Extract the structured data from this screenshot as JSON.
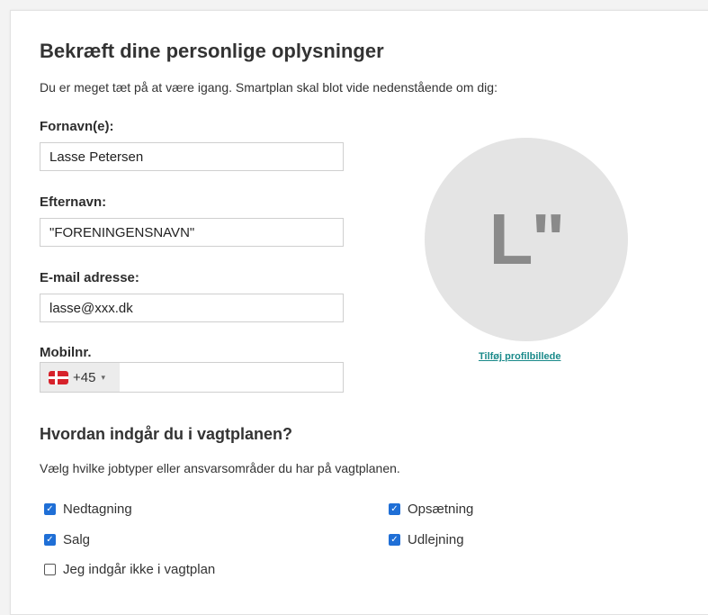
{
  "page": {
    "title": "Bekræft dine personlige oplysninger",
    "intro": "Du er meget tæt på at være igang. Smartplan skal blot vide nedenstående om dig:"
  },
  "form": {
    "first_name": {
      "label": "Fornavn(e):",
      "value": "Lasse Petersen"
    },
    "last_name": {
      "label": "Efternavn:",
      "value": "\"FORENINGENSNAVN\""
    },
    "email": {
      "label": "E-mail adresse:",
      "value": "lasse@xxx.dk"
    },
    "mobile": {
      "label": "Mobilnr.",
      "country_flag": "denmark-flag-icon",
      "dial_code": "+45",
      "caret": "▾",
      "value": ""
    }
  },
  "avatar": {
    "initials": "L\"",
    "add_photo_link": "Tilføj profilbillede"
  },
  "schedule": {
    "title": "Hvordan indgår du i vagtplanen?",
    "description": "Vælg hvilke jobtyper eller ansvarsområder du har på vagtplanen.",
    "options": [
      {
        "label": "Nedtagning",
        "checked": true
      },
      {
        "label": "Opsætning",
        "checked": true
      },
      {
        "label": "Salg",
        "checked": true
      },
      {
        "label": "Udlejning",
        "checked": true
      },
      {
        "label": "Jeg indgår ikke i vagtplan",
        "checked": false
      }
    ]
  },
  "colors": {
    "checkbox_checked": "#1f6fd6",
    "link": "#1a8a8a",
    "avatar_bg": "#e4e4e4"
  }
}
